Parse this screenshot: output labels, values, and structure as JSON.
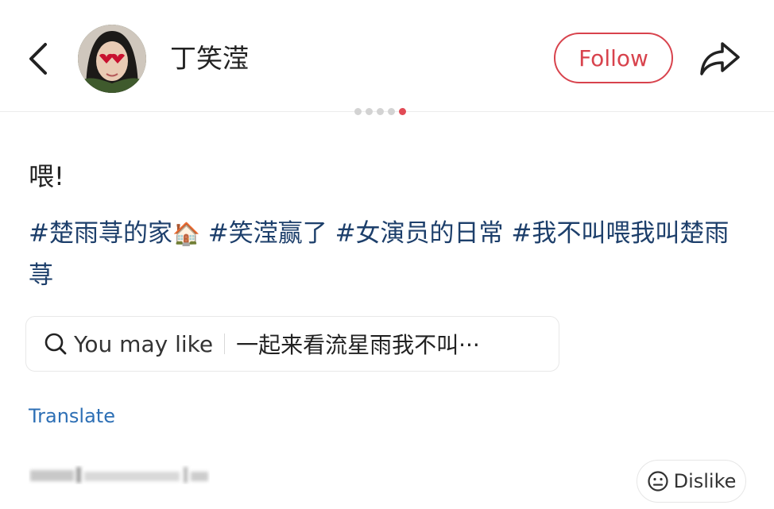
{
  "header": {
    "username": "丁笑滢",
    "follow_label": "Follow",
    "back_icon": "chevron-left-icon",
    "share_icon": "share-arrow-icon",
    "accent_color": "#d8434d"
  },
  "carousel": {
    "dot_count": 5,
    "active_index": 4
  },
  "post": {
    "text": "喂!",
    "hashtags": [
      {
        "label": "#楚雨荨的家",
        "emoji": "🏠"
      },
      {
        "label": "#笑滢赢了",
        "emoji": ""
      },
      {
        "label": "#女演员的日常",
        "emoji": ""
      },
      {
        "label": "#我不叫喂我叫楚雨荨",
        "emoji": ""
      }
    ],
    "hashtag_color": "#1d3f6b"
  },
  "suggest": {
    "label": "You may like",
    "query": "一起来看流星雨我不叫···"
  },
  "translate_label": "Translate",
  "dislike_label": "Dislike"
}
